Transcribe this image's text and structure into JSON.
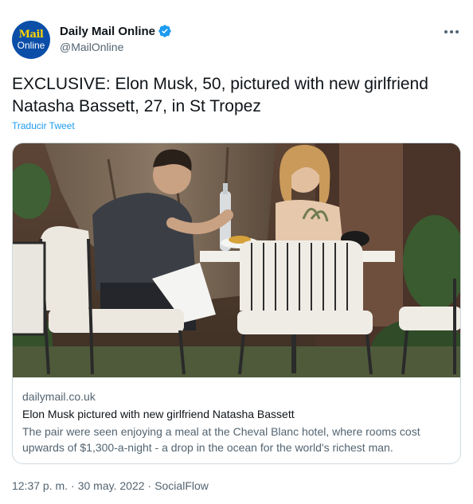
{
  "account": {
    "avatar_line1": "Mail",
    "avatar_line2": "Online",
    "display_name": "Daily Mail Online",
    "handle": "@MailOnline"
  },
  "tweet": {
    "text": "EXCLUSIVE: Elon Musk, 50, pictured with new girlfriend Natasha Bassett, 27, in St Tropez",
    "translate_label": "Traducir Tweet"
  },
  "card": {
    "domain": "dailymail.co.uk",
    "title": "Elon Musk pictured with new girlfriend Natasha Bassett",
    "description": "The pair were seen enjoying a meal at the Cheval Blanc hotel, where rooms cost upwards of $1,300-a-night - a drop in the ocean for the world's richest man."
  },
  "meta": {
    "time": "12:37 p. m.",
    "date": "30 may. 2022",
    "source": "SocialFlow",
    "separator": "·"
  },
  "colors": {
    "link": "#1d9bf0",
    "verified": "#1d9bf0",
    "secondary_text": "#536471",
    "avatar_bg": "#0a4ea8"
  },
  "icons": [
    "verified-badge-icon",
    "more-options-icon"
  ]
}
